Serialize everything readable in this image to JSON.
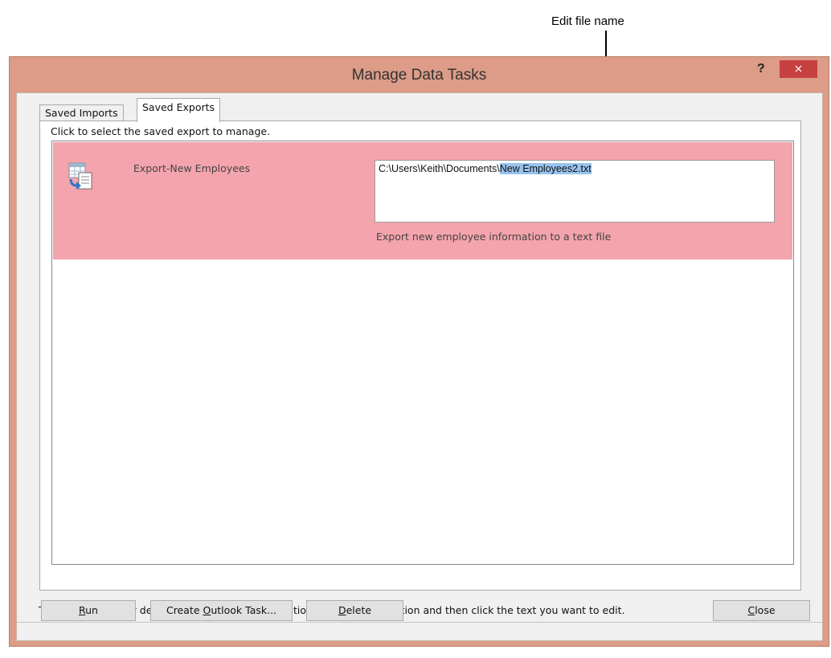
{
  "annotation": {
    "label": "Edit file name"
  },
  "window": {
    "title": "Manage Data Tasks",
    "help_label": "?",
    "close_label": "×"
  },
  "tabs": [
    {
      "label": "Saved Imports",
      "selected": false
    },
    {
      "label": "Saved Exports",
      "selected": true
    }
  ],
  "panel": {
    "instruction": "Click to select the saved export to manage.",
    "items": [
      {
        "name": "Export-New Employees",
        "path_prefix": "C:\\Users\\Keith\\Documents\\",
        "path_selected": "New Employees2.txt",
        "description": "Export new employee information to a text file",
        "icon": "export-table-icon"
      }
    ]
  },
  "footer": {
    "note": "To edit the name or description of the saved operation, select the operation and then click the text you want to edit."
  },
  "buttons": {
    "run": {
      "key": "R",
      "rest": "un"
    },
    "create_task": {
      "before": "Create ",
      "key": "O",
      "rest": "utlook Task..."
    },
    "delete": {
      "key": "D",
      "rest": "elete"
    },
    "close": {
      "key": "C",
      "rest": "lose"
    }
  },
  "colors": {
    "titlebar": "#dc9c87",
    "selected_row": "#f4a4ac",
    "text_selection": "#99c3ee",
    "close_button": "#c74040"
  }
}
